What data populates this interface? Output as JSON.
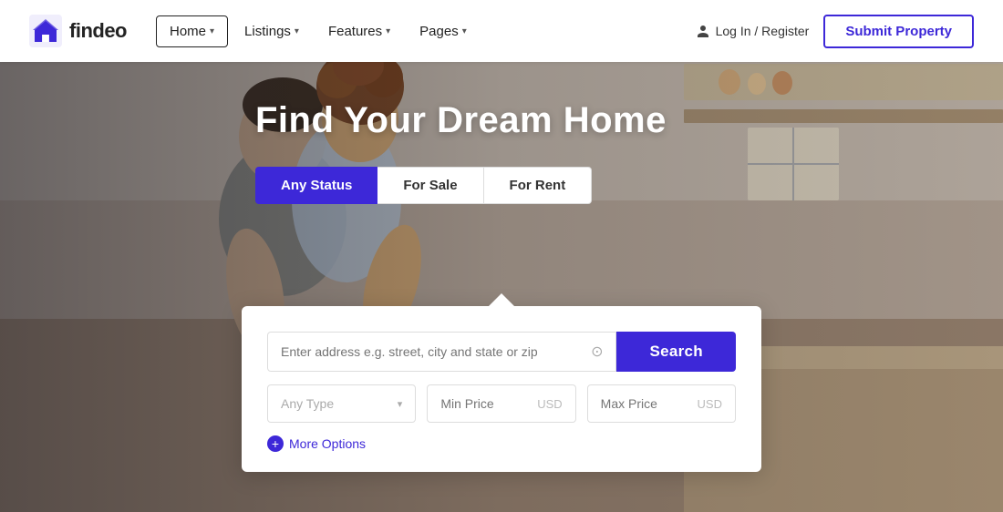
{
  "navbar": {
    "logo_text": "findeo",
    "nav_items": [
      {
        "label": "Home",
        "active": true,
        "has_chevron": true
      },
      {
        "label": "Listings",
        "active": false,
        "has_chevron": true
      },
      {
        "label": "Features",
        "active": false,
        "has_chevron": true
      },
      {
        "label": "Pages",
        "active": false,
        "has_chevron": true
      }
    ],
    "login_label": "Log In / Register",
    "submit_label": "Submit Property"
  },
  "hero": {
    "title": "Find Your Dream Home",
    "status_tabs": [
      {
        "label": "Any Status",
        "active": true
      },
      {
        "label": "For Sale",
        "active": false
      },
      {
        "label": "For Rent",
        "active": false
      }
    ]
  },
  "search": {
    "address_placeholder": "Enter address e.g. street, city and state or zip",
    "search_button": "Search",
    "type_label": "Any Type",
    "min_price_placeholder": "Min Price",
    "min_price_unit": "USD",
    "max_price_placeholder": "Max Price",
    "max_price_unit": "USD",
    "more_options_label": "More Options"
  },
  "colors": {
    "primary": "#3d28d8",
    "white": "#ffffff",
    "border": "#dddddd",
    "text_muted": "#aaaaaa"
  }
}
